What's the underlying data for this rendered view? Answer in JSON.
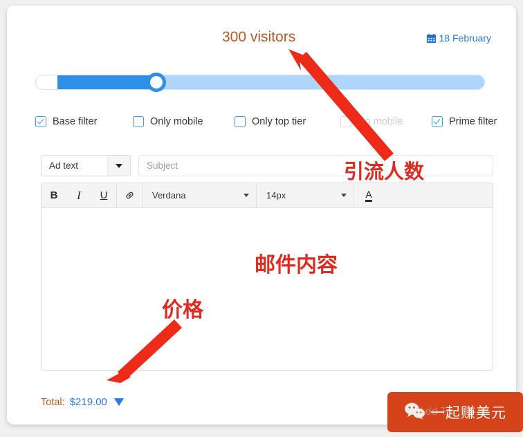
{
  "header": {
    "visitors_label": "300 visitors",
    "date_label": "18 February",
    "calendar_icon": "calendar-icon"
  },
  "slider": {
    "name": "visitors-slider",
    "value_percent": 27,
    "fill_color": "#2d8fe8",
    "track_color": "#aed6fb"
  },
  "filters": [
    {
      "label": "Base filter",
      "checked": true,
      "disabled": false
    },
    {
      "label": "Only mobile",
      "checked": false,
      "disabled": false
    },
    {
      "label": "Only top tier",
      "checked": false,
      "disabled": false
    },
    {
      "label": "No mobile",
      "checked": false,
      "disabled": true
    },
    {
      "label": "Prime filter",
      "checked": true,
      "disabled": false
    }
  ],
  "form": {
    "ad_type_value": "Ad text",
    "ad_type_caret": "chevron-down-icon",
    "subject_value": "",
    "subject_placeholder": "Subject"
  },
  "editor": {
    "toolbar": {
      "bold": "B",
      "italic": "I",
      "underline": "U",
      "link_icon": "link-icon",
      "font_value": "Verdana",
      "size_value": "14px",
      "color_glyph": "A",
      "color_caret": "chevron-down-icon"
    },
    "body_text": ""
  },
  "total": {
    "label": "Total:",
    "value": "$219.00",
    "caret": "triangle-down-icon",
    "label_color": "#c0561f",
    "value_color": "#2a7ae2"
  },
  "annotations": [
    {
      "text": "引流人数",
      "name": "annotation-visitor-count"
    },
    {
      "text": "邮件内容",
      "name": "annotation-email-content"
    },
    {
      "text": "价格",
      "name": "annotation-price"
    }
  ],
  "watermark": {
    "text": "一起赚美元",
    "ghost_text": "Add To",
    "icon": "wechat-icon",
    "bg_color": "#d4431a"
  }
}
